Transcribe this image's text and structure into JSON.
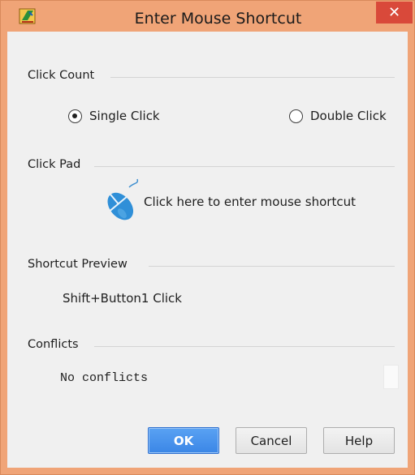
{
  "window": {
    "title": "Enter Mouse Shortcut",
    "close_glyph": "✕",
    "app_icon": "intellij-icon"
  },
  "click_count": {
    "label": "Click Count",
    "options": [
      {
        "label": "Single Click",
        "selected": true
      },
      {
        "label": "Double Click",
        "selected": false
      }
    ]
  },
  "click_pad": {
    "label": "Click Pad",
    "icon": "mouse-icon",
    "text": "Click here to enter mouse shortcut"
  },
  "shortcut_preview": {
    "label": "Shortcut Preview",
    "value": "Shift+Button1 Click"
  },
  "conflicts": {
    "label": "Conflicts",
    "value": "No conflicts"
  },
  "buttons": {
    "ok": "OK",
    "cancel": "Cancel",
    "help": "Help"
  },
  "colors": {
    "titlebar": "#f0a477",
    "close": "#d9493a",
    "primary_button": "#3b86e6",
    "client": "#f0f0f0"
  }
}
